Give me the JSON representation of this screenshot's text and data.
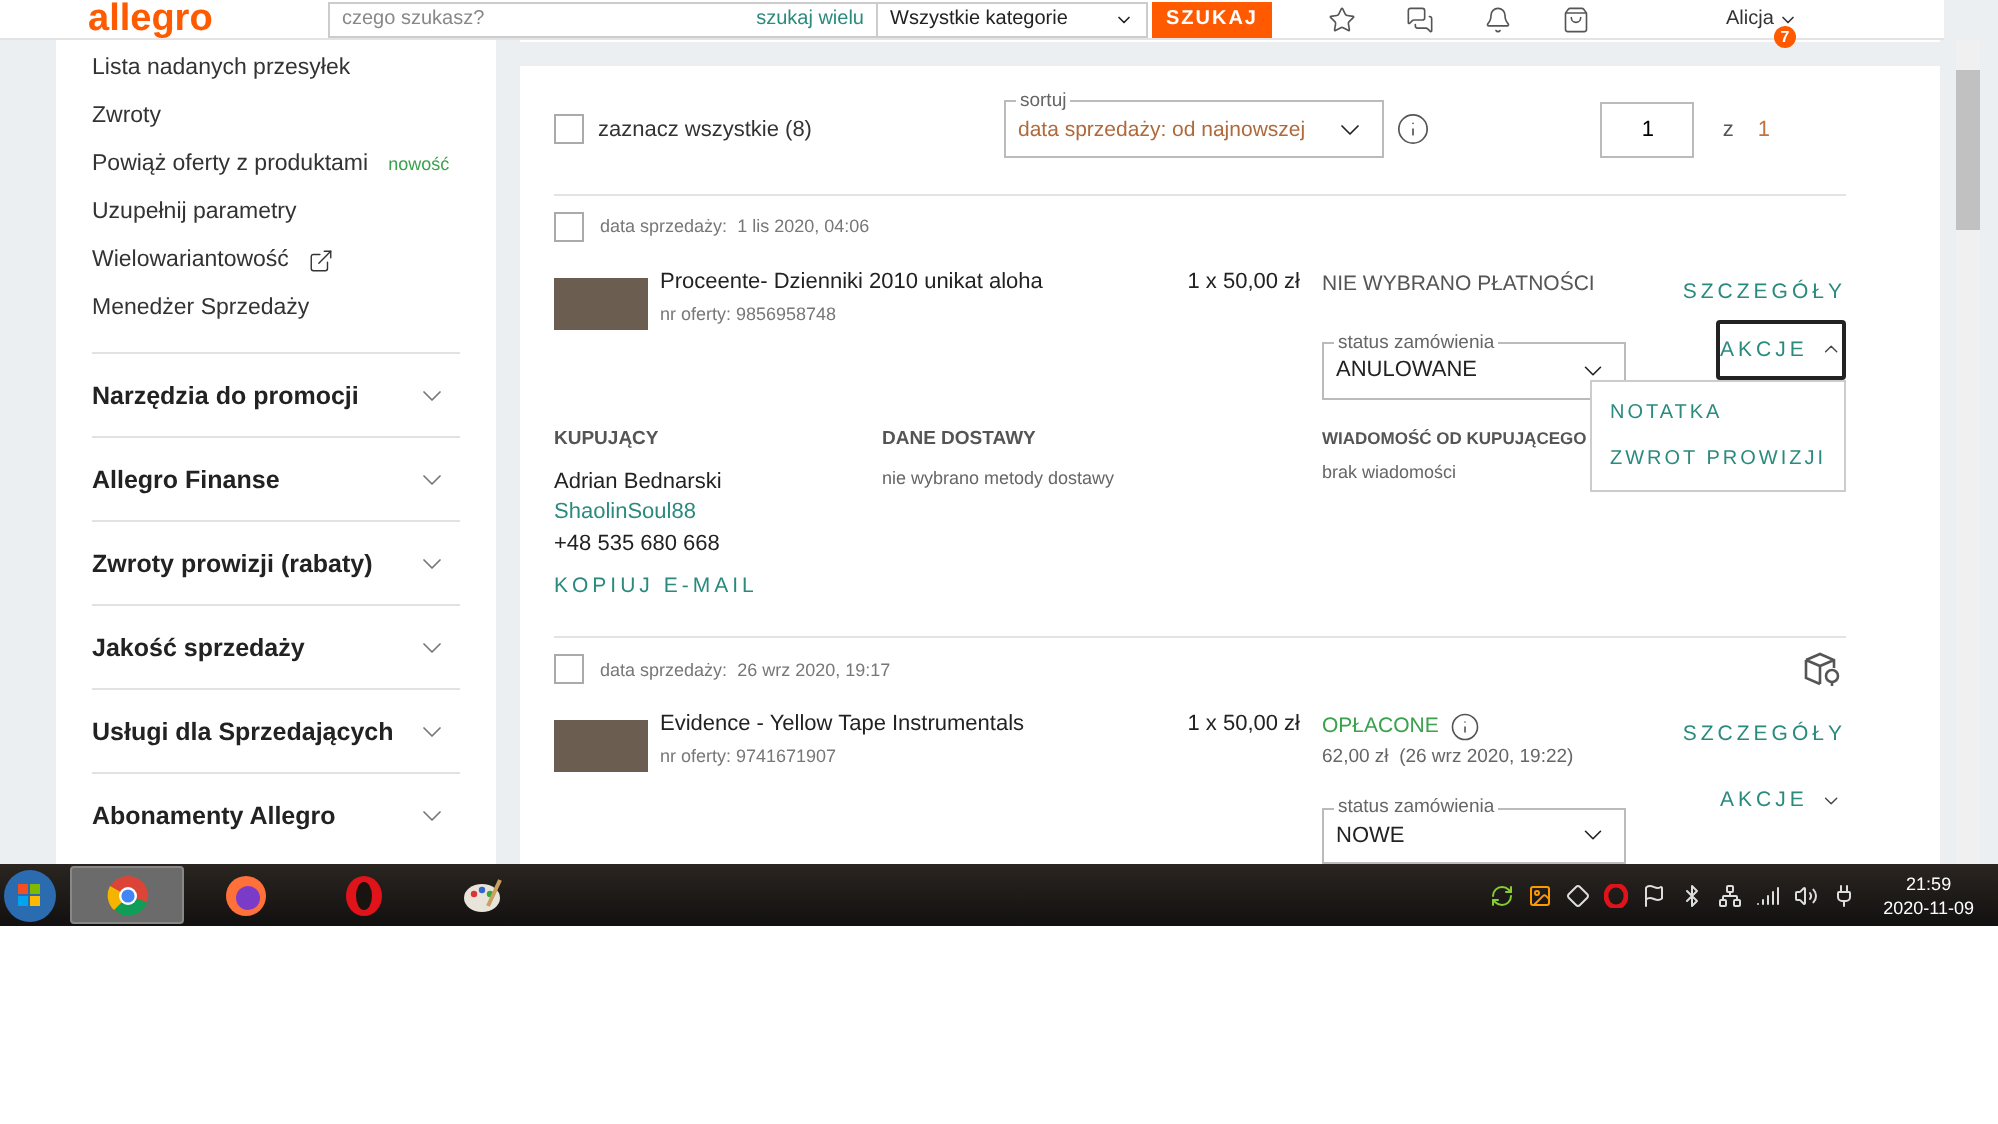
{
  "header": {
    "logo": "allegro",
    "search_placeholder": "czego szukasz?",
    "search_many": "szukaj wielu",
    "category": "Wszystkie kategorie",
    "search_button": "SZUKAJ",
    "user": "Alicja",
    "notifications": "7"
  },
  "sidebar": {
    "links": [
      {
        "label": "Lista nadanych przesyłek"
      },
      {
        "label": "Zwroty"
      },
      {
        "label": "Powiąż oferty z produktami",
        "badge": "nowość"
      },
      {
        "label": "Uzupełnij parametry"
      },
      {
        "label": "Wielowariantowość",
        "external": true
      },
      {
        "label": "Menedżer Sprzedaży"
      }
    ],
    "sections": [
      {
        "label": "Narzędzia do promocji",
        "expanded": false
      },
      {
        "label": "Allegro Finanse",
        "expanded": false
      },
      {
        "label": "Zwroty prowizji (rabaty)",
        "expanded": false
      },
      {
        "label": "Jakość sprzedaży",
        "expanded": false
      },
      {
        "label": "Usługi dla Sprzedających",
        "expanded": false
      },
      {
        "label": "Abonamenty Allegro",
        "expanded": false
      }
    ]
  },
  "list": {
    "select_all": {
      "label": "zaznacz wszystkie (8)",
      "checked": false
    },
    "sort": {
      "legend": "sortuj",
      "value": "data sprzedaży: od najnowszej"
    },
    "page": {
      "value": "1",
      "of": "z",
      "total": "1"
    }
  },
  "orders": [
    {
      "checked": false,
      "date_label": "data sprzedaży:",
      "date": "1 lis 2020, 04:06",
      "title": "Proceente- Dzienniki 2010 unikat aloha",
      "offer": "nr oferty: 9856958748",
      "price": "1 x 50,00 zł",
      "parcel_locker": false,
      "payment": {
        "kind": "none",
        "label": "NIE WYBRANO PŁATNOŚCI"
      },
      "status_legend": "status zamówienia",
      "status": "ANULOWANE",
      "details": "SZCZEGÓŁY",
      "actions": {
        "label": "AKCJE",
        "expanded": true,
        "menu": [
          "NOTATKA",
          "ZWROT PROWIZJI"
        ]
      },
      "buyer": {
        "heading": "KUPUJĄCY",
        "name": "Adrian Bednarski",
        "login": "ShaolinSoul88",
        "phone": "+48 535 680 668",
        "copy": "KOPIUJ E-MAIL"
      },
      "delivery": {
        "heading": "DANE DOSTAWY",
        "text": "nie wybrano metody dostawy"
      },
      "message": {
        "heading": "WIADOMOŚĆ OD KUPUJĄCEGO",
        "text": "brak wiadomości"
      }
    },
    {
      "checked": false,
      "date_label": "data sprzedaży:",
      "date": "26 wrz 2020, 19:17",
      "title": "Evidence - Yellow Tape Instrumentals",
      "offer": "nr oferty: 9741671907",
      "price": "1 x 50,00 zł",
      "parcel_locker": true,
      "payment": {
        "kind": "paid",
        "label": "OPŁACONE",
        "amount": "62,00 zł",
        "paid_at": "(26 wrz 2020, 19:22)"
      },
      "status_legend": "status zamówienia",
      "status": "NOWE",
      "details": "SZCZEGÓŁY",
      "actions": {
        "label": "AKCJE",
        "expanded": false
      }
    }
  ],
  "taskbar": {
    "apps": [
      {
        "kind": "chrome",
        "selected": true
      },
      {
        "kind": "firefox",
        "selected": false
      },
      {
        "kind": "opera",
        "selected": false
      },
      {
        "kind": "paint",
        "selected": false
      }
    ],
    "time": "21:59",
    "date": "2020-11-09"
  }
}
